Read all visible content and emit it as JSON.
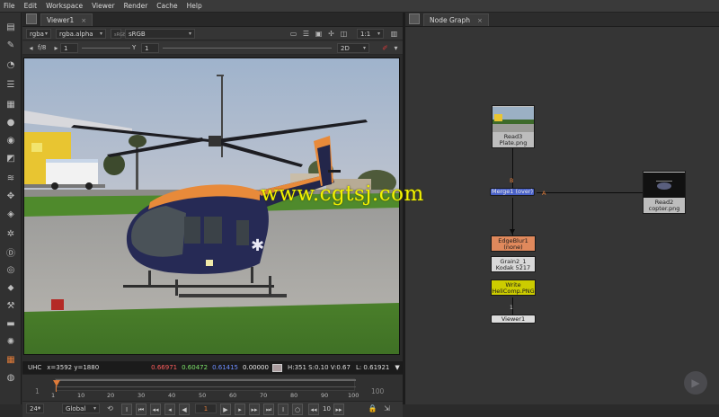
{
  "menu": [
    "File",
    "Edit",
    "Workspace",
    "Viewer",
    "Render",
    "Cache",
    "Help"
  ],
  "viewer": {
    "tab_label": "Viewer1",
    "tab_close": "×",
    "channels": "rgba",
    "alpha": "rgba.alpha",
    "colorspace_prefix": "sRGB",
    "colorspace": "sRGB",
    "zoom": "1:1",
    "fstop": "f/8",
    "gain": "1",
    "gamma_label": "Y",
    "gamma": "1",
    "view_mode": "2D"
  },
  "info": {
    "format": "UHC",
    "coords": "x=3592 y=1880",
    "r": "0.66971",
    "g": "0.60472",
    "b": "0.61415",
    "a": "0.00000",
    "hsv": "H:351 S:0.10 V:0.67",
    "lum": "L: 0.61921"
  },
  "timeline": {
    "start": "1",
    "end": "100",
    "ticks": [
      "1",
      "10",
      "20",
      "30",
      "40",
      "50",
      "60",
      "70",
      "80",
      "90",
      "100"
    ],
    "fps": "24*",
    "scope": "Global",
    "current_frame": "1",
    "skip": "10"
  },
  "nodegraph": {
    "tab_label": "Node Graph",
    "tab_close": "×",
    "nodes": {
      "read3": {
        "name": "Read3",
        "file": "Plate.png"
      },
      "merge": {
        "name": "Merge1 (over)"
      },
      "read2": {
        "name": "Read2",
        "file": "copter.png"
      },
      "edgeblur": {
        "name": "EdgeBlur1",
        "mode": "(none)"
      },
      "grain": {
        "name": "Grain2_1",
        "preset": "Kodak 5217"
      },
      "write": {
        "name": "Write",
        "file": "HeliComp.PNG"
      },
      "viewer": {
        "name": "Viewer1"
      }
    },
    "input_b": "B",
    "input_a": "A",
    "viewer_input": "1"
  },
  "watermark": "www.cgtsj.com",
  "colors": {
    "merge": "#4a62c9",
    "edgeblur": "#e0895c",
    "grain": "#d8d8d8",
    "write": "#cccc00",
    "viewer_node": "#dcdcdc",
    "watermark": "#f2f200"
  }
}
